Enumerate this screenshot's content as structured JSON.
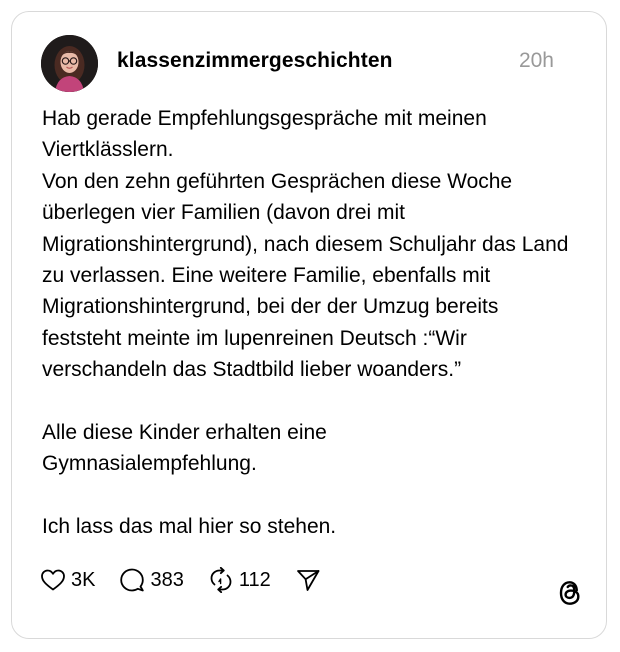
{
  "post": {
    "author": {
      "username": "klassenzimmergeschichten",
      "avatar_icon": "avatar-illustration-icon"
    },
    "timestamp": "20h",
    "paragraphs": [
      "Hab gerade Empfehlungsgespräche mit meinen Viertklässlern.",
      "Von den zehn geführten Gesprächen diese Woche überlegen vier Familien (davon drei mit Migrationshintergrund), nach diesem Schuljahr das Land zu verlassen. Eine weitere Familie, ebenfalls mit Migrationshintergrund, bei der der Umzug bereits feststeht meinte im lupenreinen Deutsch :“Wir verschandeln das Stadtbild lieber woanders.”",
      "Alle diese Kinder erhalten eine Gymnasialempfehlung.",
      "Ich lass das mal hier so stehen."
    ]
  },
  "actions": {
    "likes": "3K",
    "comments": "383",
    "reposts": "112"
  },
  "icons": {
    "like": "heart-icon",
    "comment": "comment-bubble-icon",
    "repost": "repost-icon",
    "share": "send-icon",
    "brand": "threads-logo-icon"
  },
  "colors": {
    "text": "#000000",
    "timestamp": "#999999",
    "card_border": "#d9d9d9"
  }
}
